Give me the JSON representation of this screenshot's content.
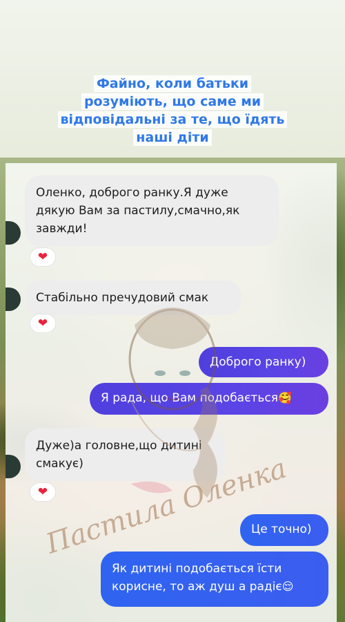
{
  "headline": "Файно, коли батьки розуміють, що саме ми відповідальні за те, що їдять наші діти",
  "messages": {
    "m1": "Оленко, доброго ранку.Я дуже дякую Вам за пастилу,смачно,як завжди!",
    "m2": "Стабільно пречудовий смак",
    "m3": "Доброго ранку)",
    "m4": "Я рада, що Вам подобається",
    "m4_emoji": "🥰",
    "m5": "Дуже)а головне,що дитині смакує)",
    "m6": "Це точно)",
    "m7": "Як дитині подобається їсти корисне, то аж душ а радіє",
    "m7_emoji": "😌"
  },
  "reaction": "❤",
  "watermark": "Пастила Оленка",
  "colors": {
    "headline": "#2f78e8",
    "outgoing_purple": "#5a44e6",
    "outgoing_blue": "#2f64f0",
    "incoming": "#ededed",
    "heart": "#e8243c"
  }
}
